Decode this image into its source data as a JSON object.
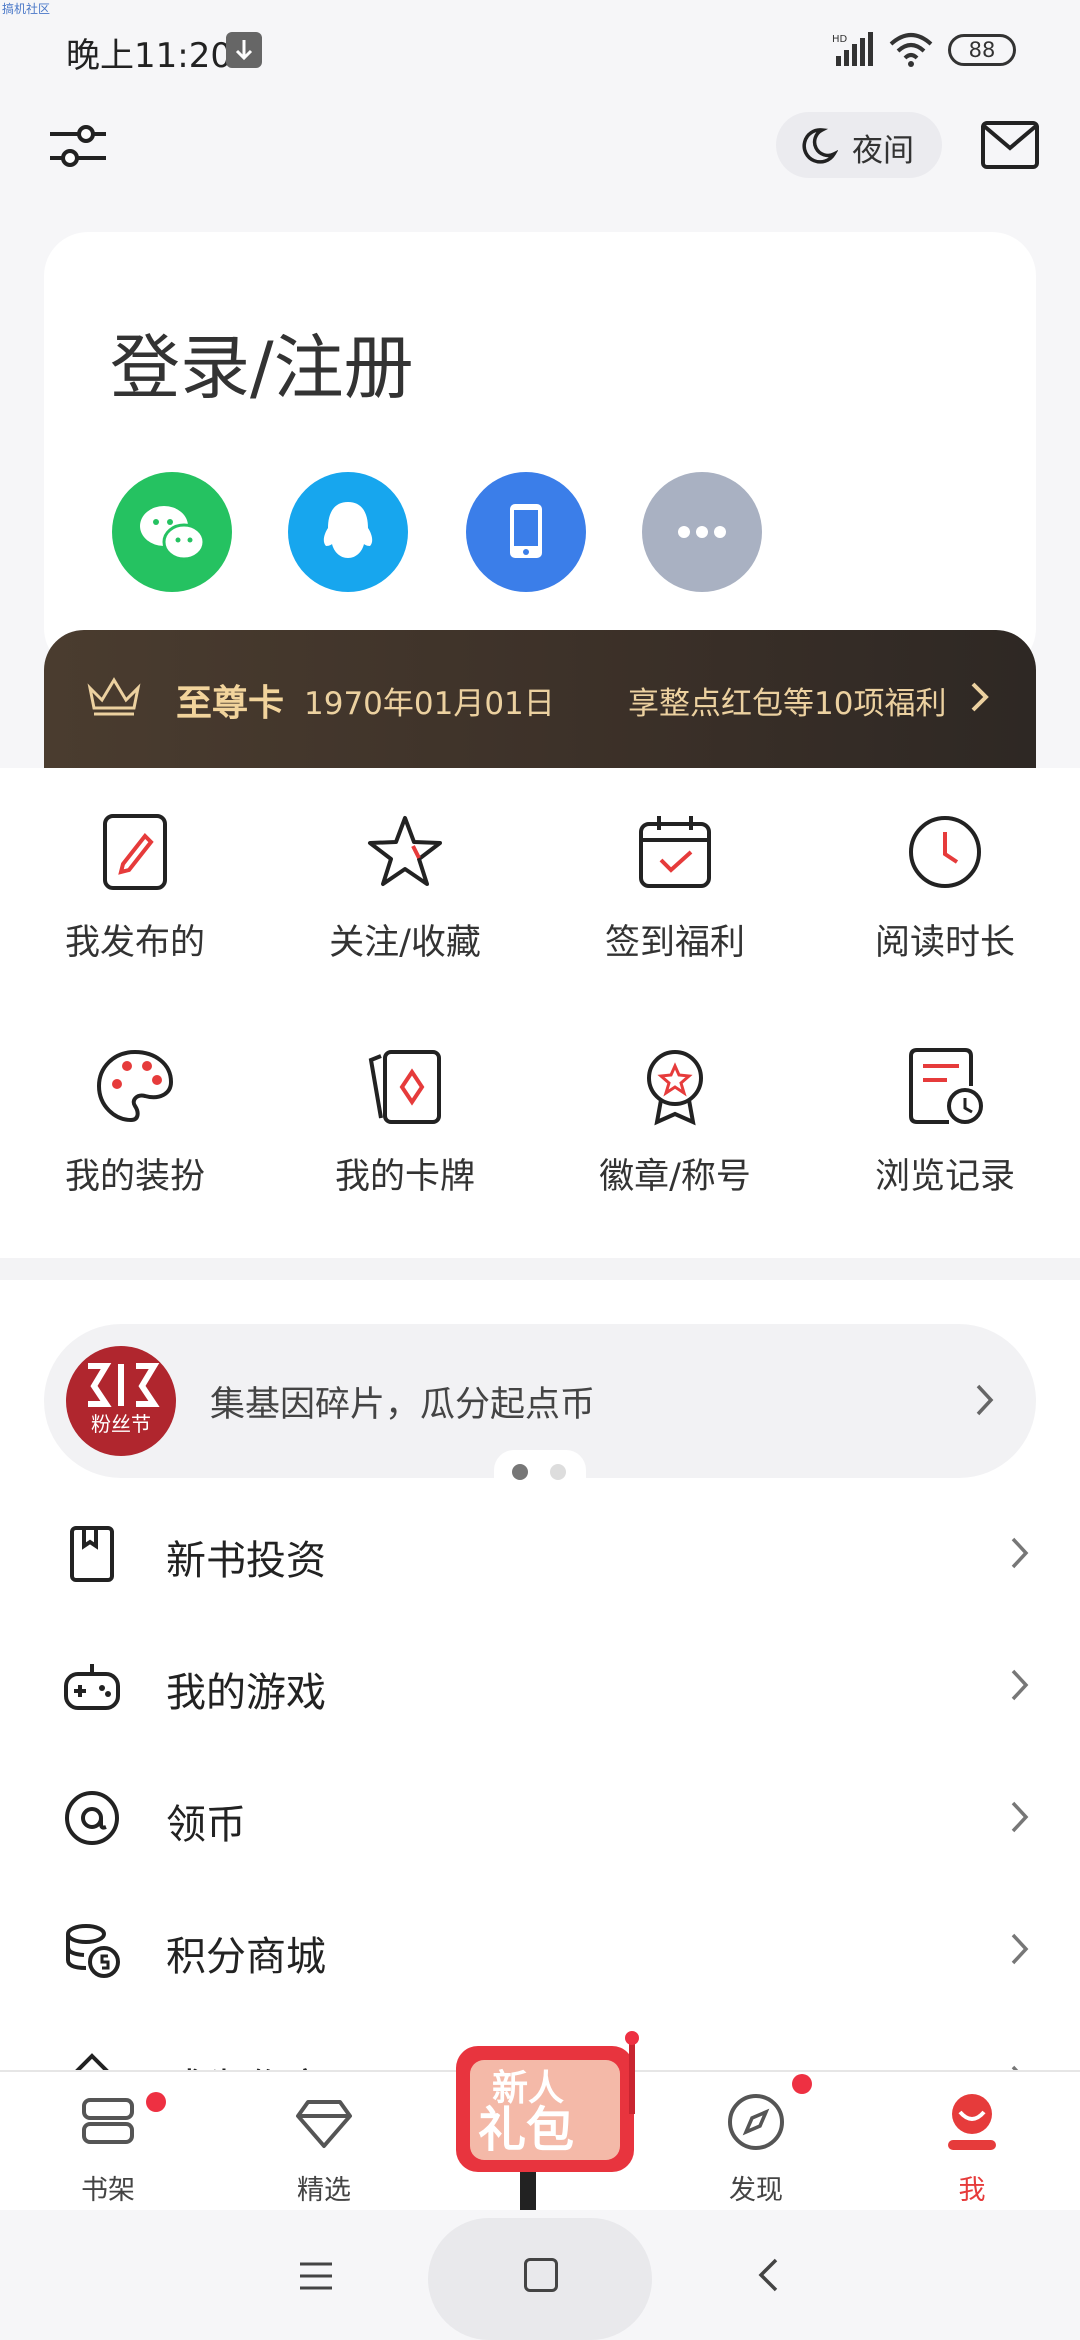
{
  "watermark": "搞机社区",
  "status_bar": {
    "time": "晚上11:20",
    "battery": "88",
    "signal_label": "HD"
  },
  "top_bar": {
    "night_label": "夜间"
  },
  "login": {
    "title": "登录/注册",
    "providers": [
      "wechat-icon",
      "qq-icon",
      "phone-icon",
      "more-icon"
    ]
  },
  "vip": {
    "name": "至尊卡",
    "date": "1970年01月01日",
    "benefit": "享整点红包等10项福利"
  },
  "grid": [
    {
      "label": "我发布的",
      "icon": "edit-doc-icon"
    },
    {
      "label": "关注/收藏",
      "icon": "star-icon"
    },
    {
      "label": "签到福利",
      "icon": "calendar-check-icon"
    },
    {
      "label": "阅读时长",
      "icon": "clock-icon"
    },
    {
      "label": "我的装扮",
      "icon": "palette-icon"
    },
    {
      "label": "我的卡牌",
      "icon": "cards-icon"
    },
    {
      "label": "徽章/称号",
      "icon": "badge-icon"
    },
    {
      "label": "浏览记录",
      "icon": "history-icon"
    }
  ],
  "banner": {
    "logo_text": "粉丝节",
    "text": "集基因碎片，瓜分起点币"
  },
  "list": [
    {
      "label": "新书投资",
      "icon": "bookmark-icon"
    },
    {
      "label": "我的游戏",
      "icon": "gamepad-icon"
    },
    {
      "label": "领币",
      "icon": "at-coin-icon"
    },
    {
      "label": "积分商城",
      "icon": "coins-icon"
    },
    {
      "label": "成为作家",
      "icon": "pen-icon"
    }
  ],
  "bottom_nav": [
    {
      "label": "书架",
      "icon": "bookshelf-icon"
    },
    {
      "label": "精选",
      "icon": "diamond-icon"
    },
    {
      "label": "",
      "icon": "gift-icon"
    },
    {
      "label": "发现",
      "icon": "compass-icon"
    },
    {
      "label": "我",
      "icon": "profile-icon"
    }
  ],
  "gift_text": [
    "新人",
    "礼包"
  ],
  "colors": {
    "accent": "#e63b3b",
    "vip_gold": "#ecd1a0",
    "wechat": "#25c261",
    "qq": "#17a6ee",
    "phone": "#3b7ee9"
  }
}
